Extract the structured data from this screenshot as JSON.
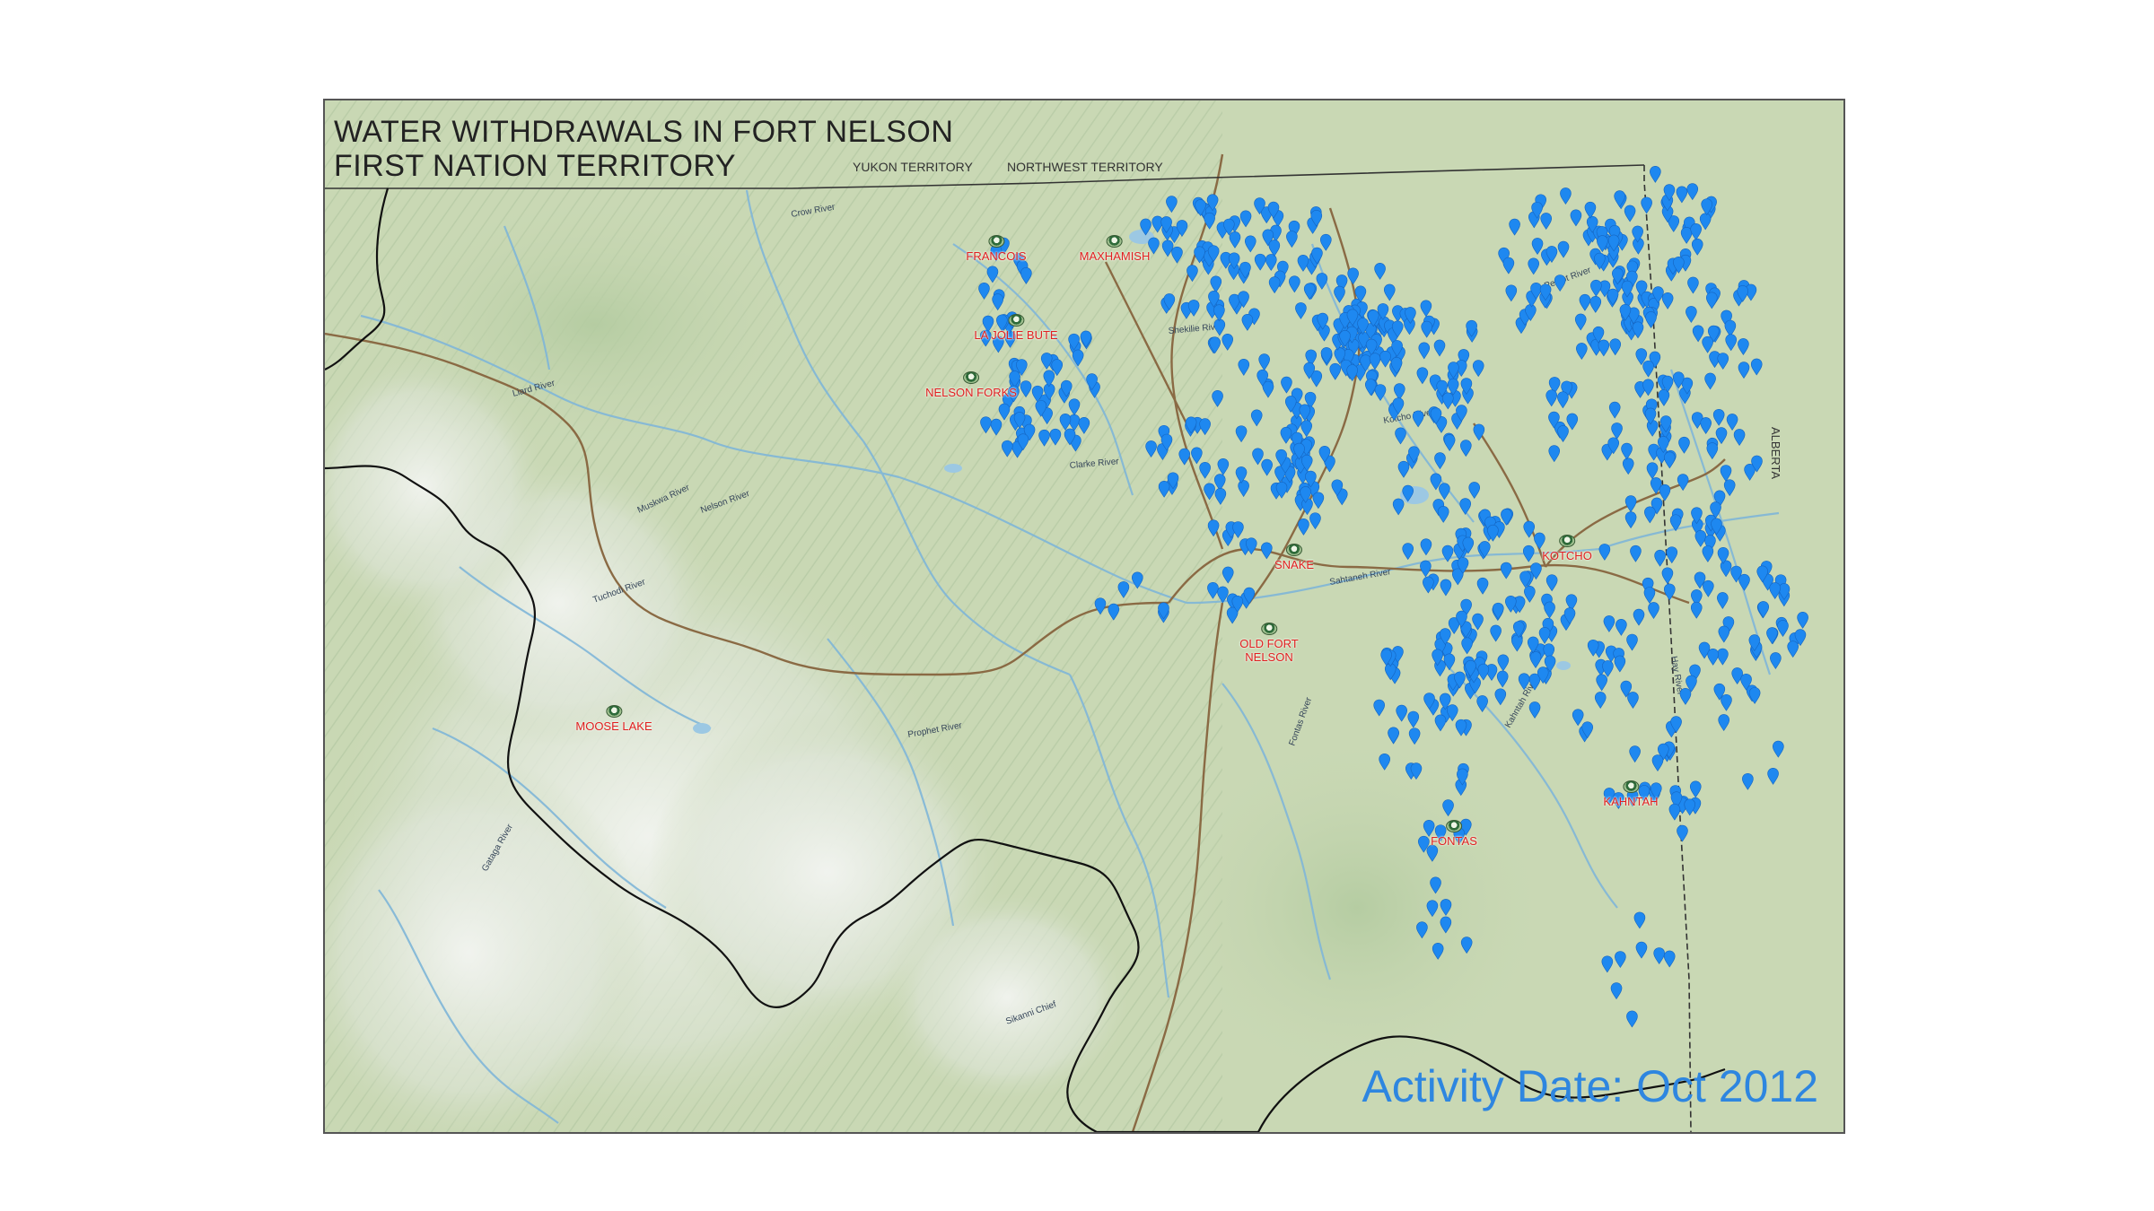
{
  "title_line1": "WATER WITHDRAWALS IN FORT NELSON",
  "title_line2": "FIRST NATION TERRITORY",
  "territory_labels": {
    "yukon": "YUKON TERRITORY",
    "northwest": "NORTHWEST TERRITORY",
    "alberta": "ALBERTA"
  },
  "activity_date": "Activity Date: Oct 2012",
  "places": [
    {
      "name": "FRANCOIS"
    },
    {
      "name": "MAXHAMISH"
    },
    {
      "name": "LA JOLIE BUTE"
    },
    {
      "name": "NELSON FORKS"
    },
    {
      "name": "SNAKE"
    },
    {
      "name": "KOTCHO"
    },
    {
      "name": "OLD FORT"
    },
    {
      "name": "NELSON"
    },
    {
      "name": "MOOSE LAKE"
    },
    {
      "name": "KAHNTAH"
    },
    {
      "name": "FONTAS"
    }
  ],
  "colors": {
    "land": "#c9d8b4",
    "mountain_snow": "#eef1ec",
    "withdrawal_marker": "#1e88f0",
    "place_label": "#e02020",
    "road": "#8a6a44",
    "river": "#7fb6d8",
    "boundary": "#111111",
    "activity_date_text": "#2e86e0"
  },
  "icons": {
    "withdrawal_marker": "blue-teardrop-pin",
    "community": "green-circular-community-icon"
  }
}
